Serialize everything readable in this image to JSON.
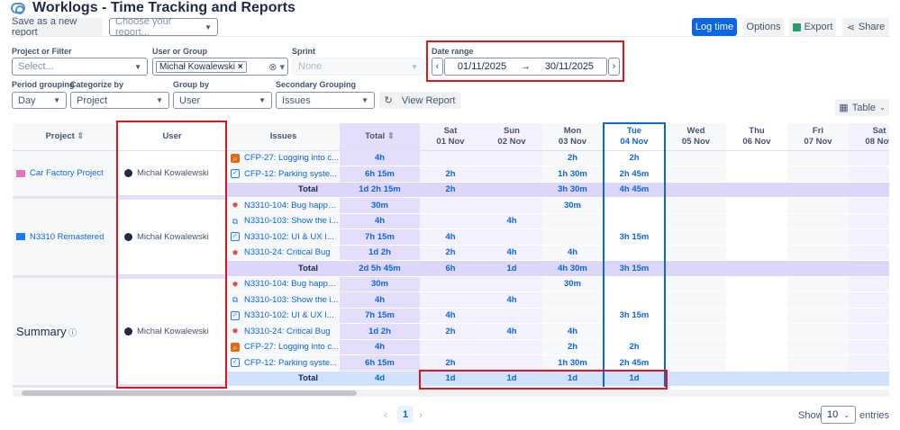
{
  "header": {
    "title": "Worklogs - Time Tracking and Reports",
    "save_label": "Save as a new report",
    "report_placeholder": "Choose your report...",
    "log_time": "Log time",
    "options": "Options",
    "export": "Export",
    "share": "Share"
  },
  "filters": {
    "project_label": "Project or Filter",
    "project_placeholder": "Select...",
    "user_label": "User or Group",
    "user_chip": "Michał Kowalewski",
    "sprint_label": "Sprint",
    "sprint_value": "None",
    "date_label": "Date range",
    "date_from": "01/11/2025",
    "date_arrow": "→",
    "date_to": "30/11/2025",
    "period_label": "Period grouping",
    "period_value": "Day",
    "categorize_label": "Categorize by",
    "categorize_value": "Project",
    "group_label": "Group by",
    "group_value": "User",
    "secondary_label": "Secondary Grouping",
    "secondary_value": "Issues",
    "view_report": "View Report",
    "view_mode": "Table"
  },
  "table": {
    "columns": {
      "project": "Project",
      "user": "User",
      "issues": "Issues",
      "total": "Total"
    },
    "days": [
      {
        "dow": "Sat",
        "date": "01 Nov",
        "type": "we"
      },
      {
        "dow": "Sun",
        "date": "02 Nov",
        "type": "we"
      },
      {
        "dow": "Mon",
        "date": "03 Nov",
        "type": "wd"
      },
      {
        "dow": "Tue",
        "date": "04 Nov",
        "type": "today"
      },
      {
        "dow": "Wed",
        "date": "05 Nov",
        "type": "wd"
      },
      {
        "dow": "Thu",
        "date": "06 Nov",
        "type": "w"
      },
      {
        "dow": "Fri",
        "date": "07 Nov",
        "type": "wd"
      },
      {
        "dow": "Sat",
        "date": "08 Nov",
        "type": "we"
      }
    ],
    "groups": [
      {
        "project": "Car Factory Project",
        "project_icon": "car-icon",
        "user": "Michał Kowalewski",
        "rows": [
          {
            "issue": "CFP-27: Logging into c...",
            "type": "search",
            "total": "4h",
            "cells": [
              "",
              "",
              "2h",
              "2h",
              "",
              "",
              "",
              ""
            ]
          },
          {
            "issue": "CFP-12: Parking syste...",
            "type": "task",
            "total": "6h 15m",
            "cells": [
              "2h",
              "",
              "1h 30m",
              "2h 45m",
              "",
              "",
              "",
              ""
            ]
          }
        ],
        "total": {
          "label": "Total",
          "total": "1d 2h 15m",
          "cells": [
            "2h",
            "",
            "3h 30m",
            "4h 45m",
            "",
            "",
            "",
            ""
          ]
        }
      },
      {
        "project": "N3310 Remastered",
        "project_icon": "cloud-icon",
        "user": "Michał Kowalewski",
        "rows": [
          {
            "issue": "N3310-104: Bug happe...",
            "type": "bug",
            "total": "30m",
            "cells": [
              "",
              "",
              "30m",
              "",
              "",
              "",
              "",
              ""
            ]
          },
          {
            "issue": "N3310-103: Show the i...",
            "type": "story",
            "total": "4h",
            "cells": [
              "",
              "4h",
              "",
              "",
              "",
              "",
              "",
              ""
            ]
          },
          {
            "issue": "N3310-102: UI & UX I...",
            "type": "task",
            "total": "7h 15m",
            "cells": [
              "4h",
              "",
              "",
              "3h 15m",
              "",
              "",
              "",
              ""
            ]
          },
          {
            "issue": "N3310-24: Critical Bug",
            "type": "bug",
            "total": "1d 2h",
            "cells": [
              "2h",
              "4h",
              "4h",
              "",
              "",
              "",
              "",
              ""
            ]
          }
        ],
        "total": {
          "label": "Total",
          "total": "2d 5h 45m",
          "cells": [
            "6h",
            "1d",
            "4h 30m",
            "3h 15m",
            "",
            "",
            "",
            ""
          ]
        }
      },
      {
        "project": "Summary",
        "summary": true,
        "user": "Michał Kowalewski",
        "rows": [
          {
            "issue": "N3310-104: Bug happe...",
            "type": "bug",
            "total": "30m",
            "cells": [
              "",
              "",
              "30m",
              "",
              "",
              "",
              "",
              ""
            ]
          },
          {
            "issue": "N3310-103: Show the i...",
            "type": "story",
            "total": "4h",
            "cells": [
              "",
              "4h",
              "",
              "",
              "",
              "",
              "",
              ""
            ]
          },
          {
            "issue": "N3310-102: UI & UX I...",
            "type": "task",
            "total": "7h 15m",
            "cells": [
              "4h",
              "",
              "",
              "3h 15m",
              "",
              "",
              "",
              ""
            ]
          },
          {
            "issue": "N3310-24: Critical Bug",
            "type": "bug",
            "total": "1d 2h",
            "cells": [
              "2h",
              "4h",
              "4h",
              "",
              "",
              "",
              "",
              ""
            ]
          },
          {
            "issue": "CFP-27: Logging into c...",
            "type": "search",
            "total": "4h",
            "cells": [
              "",
              "",
              "2h",
              "2h",
              "",
              "",
              "",
              ""
            ]
          },
          {
            "issue": "CFP-12: Parking syste...",
            "type": "task",
            "total": "6h 15m",
            "cells": [
              "2h",
              "",
              "1h 30m",
              "2h 45m",
              "",
              "",
              "",
              ""
            ]
          }
        ],
        "total": {
          "label": "Total",
          "total": "4d",
          "cells": [
            "1d",
            "1d",
            "1d",
            "1d",
            "",
            "",
            "",
            ""
          ]
        }
      }
    ]
  },
  "pagination": {
    "page": "1",
    "show": "Show",
    "entries_value": "10",
    "entries": "entries"
  },
  "colors": {
    "accent": "#0c66e4",
    "highlight": "#e3141b",
    "total_bg": "#dcd6f8",
    "summary_bg": "#cfe1fb"
  }
}
